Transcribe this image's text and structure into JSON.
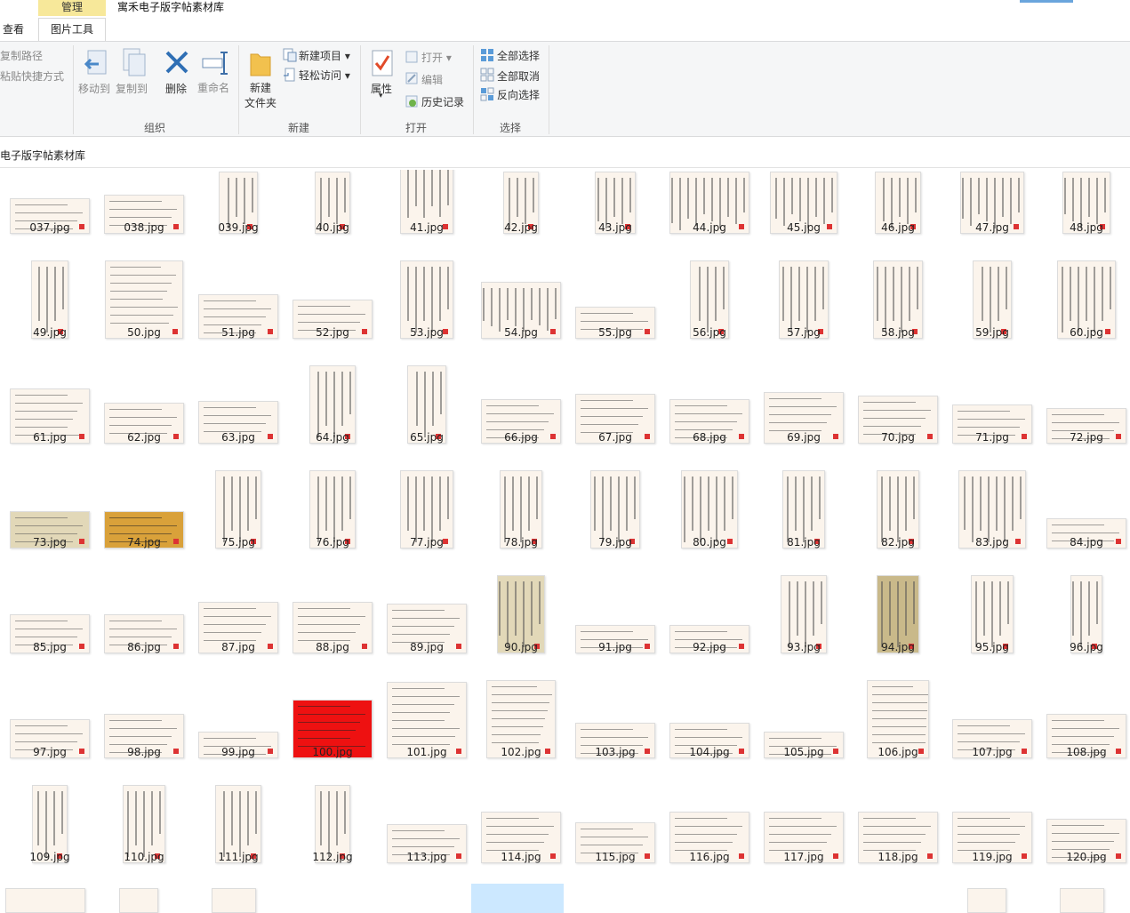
{
  "window": {
    "context_tab": "管理",
    "title": "寓禾电子版字帖素材库",
    "tab_view": "查看",
    "tab_picture_tools": "图片工具"
  },
  "ribbon": {
    "copy_path": "复制路径",
    "paste_shortcut": "粘贴快捷方式",
    "move_to": "移动到",
    "copy_to": "复制到",
    "delete": "删除",
    "rename": "重命名",
    "new_folder_l1": "新建",
    "new_folder_l2": "文件夹",
    "new_item": "新建项目",
    "easy_access": "轻松访问",
    "properties": "属性",
    "open": "打开",
    "edit": "编辑",
    "history": "历史记录",
    "select_all": "全部选择",
    "select_none": "全部取消",
    "invert_selection": "反向选择",
    "group_organize": "组织",
    "group_new": "新建",
    "group_open": "打开",
    "group_select": "选择"
  },
  "address": "电子版字帖素材库",
  "files": [
    "037.jpg",
    "038.jpg",
    "039.jpg",
    "40.jpg",
    "41.jpg",
    "42.jpg",
    "43.jpg",
    "44.jpg",
    "45.jpg",
    "46.jpg",
    "47.jpg",
    "48.jpg",
    "49.jpg",
    "50.jpg",
    "51.jpg",
    "52.jpg",
    "53.jpg",
    "54.jpg",
    "55.jpg",
    "56.jpg",
    "57.jpg",
    "58.jpg",
    "59.jpg",
    "60.jpg",
    "61.jpg",
    "62.jpg",
    "63.jpg",
    "64.jpg",
    "65.jpg",
    "66.jpg",
    "67.jpg",
    "68.jpg",
    "69.jpg",
    "70.jpg",
    "71.jpg",
    "72.jpg",
    "73.jpg",
    "74.jpg",
    "75.jpg",
    "76.jpg",
    "77.jpg",
    "78.jpg",
    "79.jpg",
    "80.jpg",
    "81.jpg",
    "82.jpg",
    "83.jpg",
    "84.jpg",
    "85.jpg",
    "86.jpg",
    "87.jpg",
    "88.jpg",
    "89.jpg",
    "90.jpg",
    "91.jpg",
    "92.jpg",
    "93.jpg",
    "94.jpg",
    "95.jpg",
    "96.jpg",
    "97.jpg",
    "98.jpg",
    "99.jpg",
    "100.jpg",
    "101.jpg",
    "102.jpg",
    "103.jpg",
    "104.jpg",
    "105.jpg",
    "106.jpg",
    "107.jpg",
    "108.jpg",
    "109.jpg",
    "110.jpg",
    "111.jpg",
    "112.jpg",
    "113.jpg",
    "114.jpg",
    "115.jpg",
    "116.jpg",
    "117.jpg",
    "118.jpg",
    "119.jpg",
    "120.jpg"
  ],
  "colors": {
    "manage_tab": "#f7e89a",
    "ribbon_bg": "#f5f6f7",
    "selection": "#cce8ff",
    "paper": "#fbf4ec",
    "gold_paper": "#d9a13a",
    "red_paper": "#ee1111",
    "parchment": "#e2d8b8",
    "olive_paper": "#c9b98a"
  }
}
